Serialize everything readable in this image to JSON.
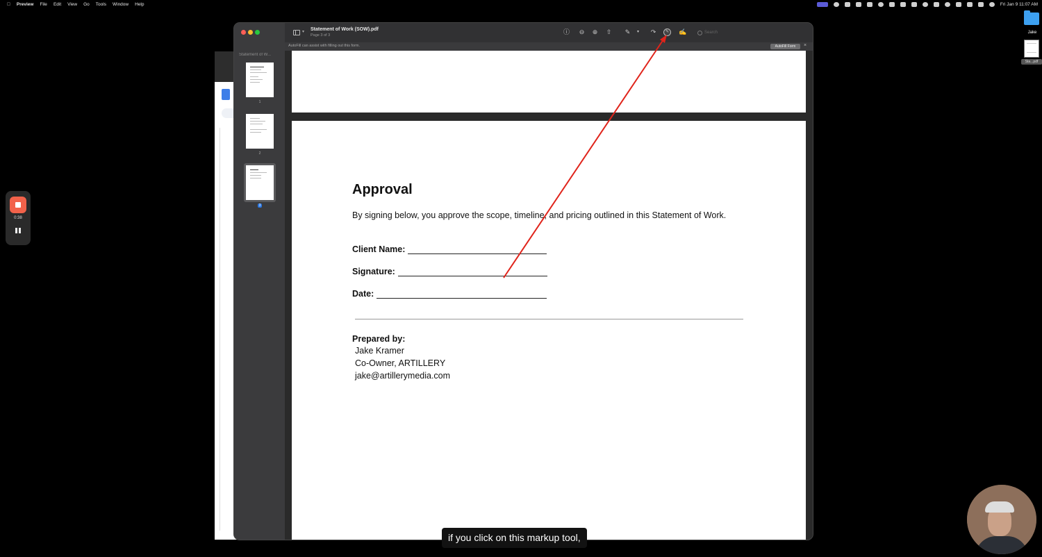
{
  "menubar": {
    "app": "Preview",
    "items": [
      "File",
      "Edit",
      "View",
      "Go",
      "Tools",
      "Window",
      "Help"
    ],
    "clock": "Fri Jan 9  11:07 AM"
  },
  "desktop": {
    "folder_label": "Jake",
    "file_label": "Sta...pdf"
  },
  "recorder": {
    "time": "0:38"
  },
  "preview": {
    "sidebar_title": "Statement of W...",
    "doc_title": "Statement of Work (SOW).pdf",
    "page_info": "Page 3 of 3",
    "search_placeholder": "Search",
    "autofill_text": "AutoFill can assist with filling out this form.",
    "autofill_button": "AutoFill Form",
    "thumbnails": [
      {
        "num": "1",
        "selected": false
      },
      {
        "num": "2",
        "selected": false
      },
      {
        "num": "3",
        "selected": true
      }
    ],
    "icons": [
      "info-icon",
      "zoom-out-icon",
      "zoom-in-icon",
      "share-icon",
      "pen-icon",
      "rotate-icon",
      "markup-icon",
      "signature-icon"
    ]
  },
  "document": {
    "title": "Approval",
    "body": "By signing below, you approve the scope, timeline, and pricing outlined in this Statement of Work.",
    "fields": [
      {
        "label": "Client Name:"
      },
      {
        "label": "Signature:"
      },
      {
        "label": "Date:"
      }
    ],
    "prepared_label": "Prepared by:",
    "prepared_lines": [
      "Jake Kramer",
      "Co-Owner, ARTILLERY",
      "jake@artillerymedia.com"
    ]
  },
  "caption": "if you click on this markup tool,",
  "colors": {
    "arrow": "#e0241b",
    "record": "#f2624a",
    "selection": "#2b77e0"
  }
}
